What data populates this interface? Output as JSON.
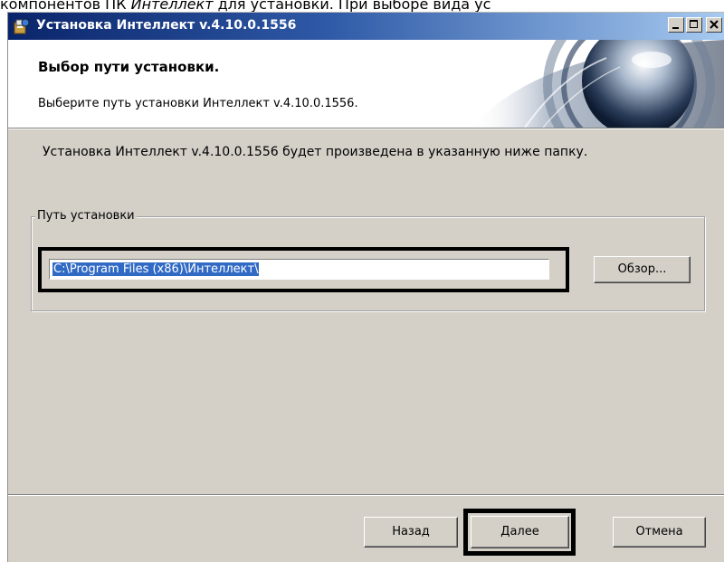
{
  "doc_text": {
    "prefix": "компонентов ПК ",
    "italic": "Интеллект",
    "suffix": " для установки. При выборе вида ус"
  },
  "window": {
    "title": "Установка Интеллект v.4.10.0.1556"
  },
  "header": {
    "title": "Выбор пути установки.",
    "subtitle": "Выберите путь установки Интеллект v.4.10.0.1556."
  },
  "body": {
    "description": "Установка Интеллект v.4.10.0.1556 будет произведена в указанную ниже папку."
  },
  "install_path": {
    "group_label": "Путь установки",
    "value": "C:\\Program Files (x86)\\Интеллект\\",
    "browse_label": "Обзор..."
  },
  "footer": {
    "back_label": "Назад",
    "next_label": "Далее",
    "cancel_label": "Отмена"
  },
  "icons": {
    "app": "installer-icon",
    "minimize": "minimize-icon",
    "maximize": "maximize-icon",
    "close": "close-icon"
  },
  "colors": {
    "titlebar_start": "#0a246a",
    "titlebar_end": "#a6caf0",
    "dialog_bg": "#d4d0c8",
    "selection": "#316ac5"
  }
}
